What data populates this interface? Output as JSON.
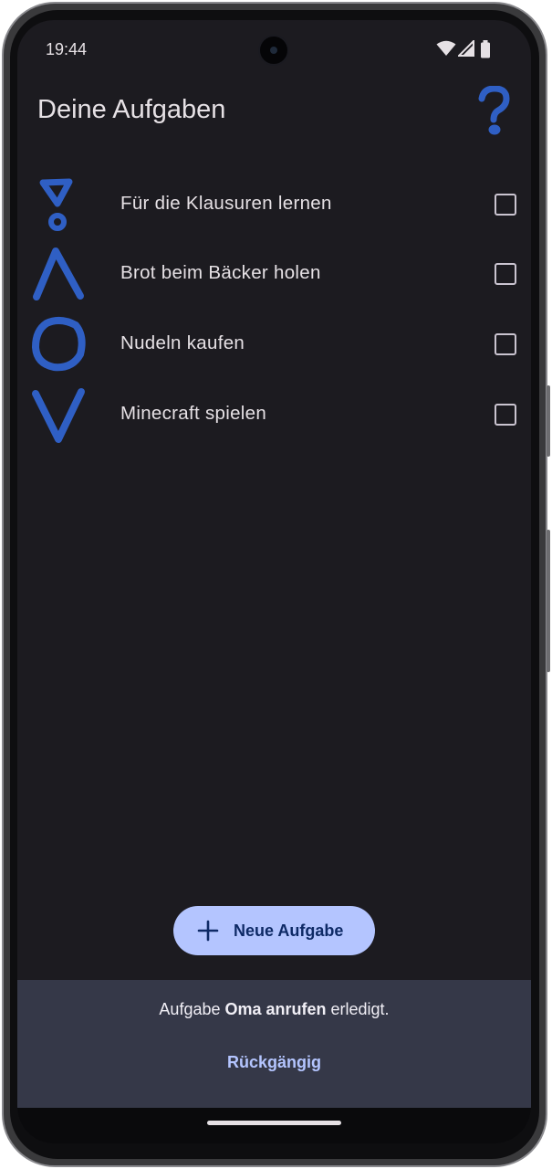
{
  "status_bar": {
    "time": "19:44",
    "icons": [
      "wifi-icon",
      "cellular-icon",
      "battery-icon"
    ]
  },
  "app": {
    "title": "Deine Aufgaben",
    "help_icon": "question-mark-icon",
    "accent_color": "#2f5fc4"
  },
  "tasks": [
    {
      "label": "Für die Klausuren lernen",
      "glyph": "triangle-dot-glyph",
      "checked": false
    },
    {
      "label": "Brot beim Bäcker holen",
      "glyph": "caret-up-glyph",
      "checked": false
    },
    {
      "label": "Nudeln kaufen",
      "glyph": "circle-glyph",
      "checked": false
    },
    {
      "label": "Minecraft spielen",
      "glyph": "caret-down-glyph",
      "checked": false
    }
  ],
  "fab": {
    "icon": "plus-icon",
    "label": "Neue Aufgabe"
  },
  "snackbar": {
    "message_prefix": "Aufgabe ",
    "message_task": "Oma anrufen",
    "message_suffix": " erledigt.",
    "action_label": "Rückgängig"
  }
}
